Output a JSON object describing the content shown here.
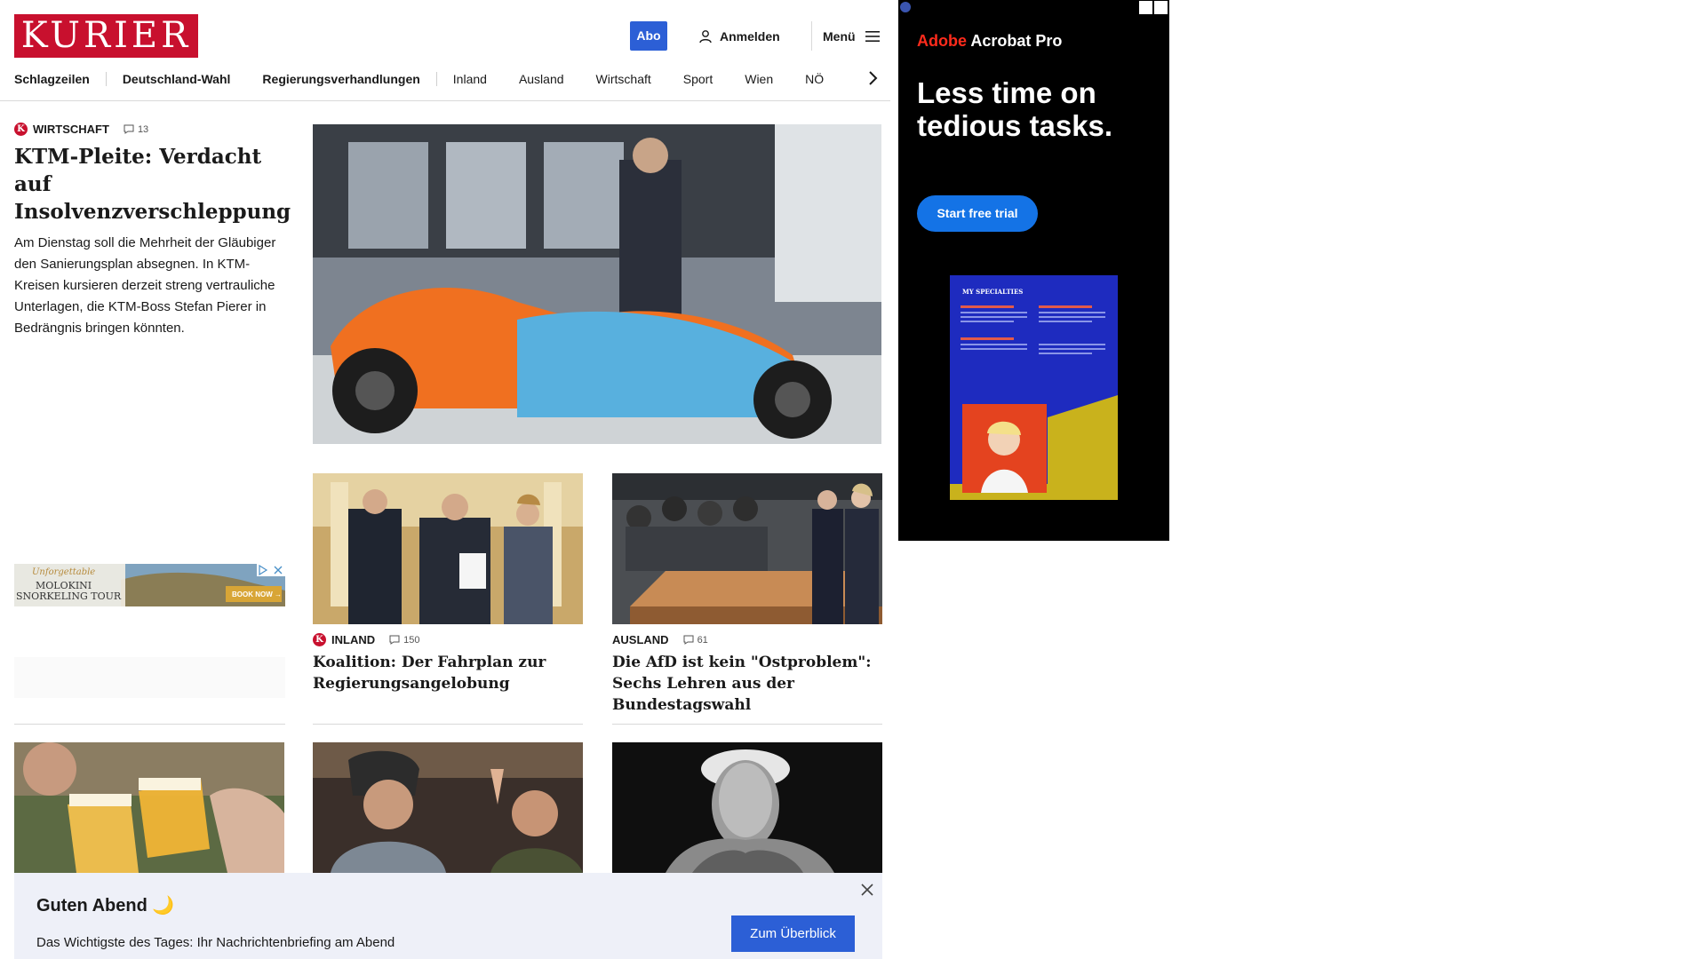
{
  "header": {
    "logo": "KURIER",
    "abo": "Abo",
    "login": "Anmelden",
    "menu": "Menü"
  },
  "nav": [
    "Schlagzeilen",
    "Deutschland-Wahl",
    "Regierungsverhandlungen",
    "Inland",
    "Ausland",
    "Wirtschaft",
    "Sport",
    "Wien",
    "NÖ"
  ],
  "lead": {
    "category": "Wirtschaft",
    "comments": "13",
    "headline": "KTM-Pleite: Verdacht auf Insolvenzverschleppung",
    "teaser": "Am Dienstag soll die Mehrheit der Gläubiger den Sanierungsplan absegnen. In KTM-Kreisen kursieren derzeit streng vertrauliche Unterlagen, die KTM-Boss Stefan Pierer in Bedrängnis bringen könnten."
  },
  "cards": [
    {
      "category": "Inland",
      "comments": "150",
      "headline": "Koalition: Der Fahrplan zur Regierungsangelobung"
    },
    {
      "category": "Ausland",
      "comments": "61",
      "headline": "Die AfD ist kein \"Ostproblem\": Sechs Lehren aus der Bundestagswahl"
    }
  ],
  "left_ad": {
    "script": "Unforgettable",
    "line1": "MOLOKINI",
    "line2": "SNORKELING TOUR",
    "cta": "BOOK NOW →"
  },
  "banner": {
    "title": "Guten Abend 🌙",
    "text": "Das Wichtigste des Tages: Ihr Nachrichtenbriefing am Abend",
    "button": "Zum Überblick"
  },
  "ad": {
    "brand_red": "Adobe",
    "brand_white": " Acrobat Pro",
    "headline": "Less time on tedious tasks.",
    "button": "Start free trial",
    "card_title": "MY SPECIALTIES"
  },
  "colors": {
    "brand_red": "#c8102e",
    "accent_blue": "#2c5fd6"
  }
}
